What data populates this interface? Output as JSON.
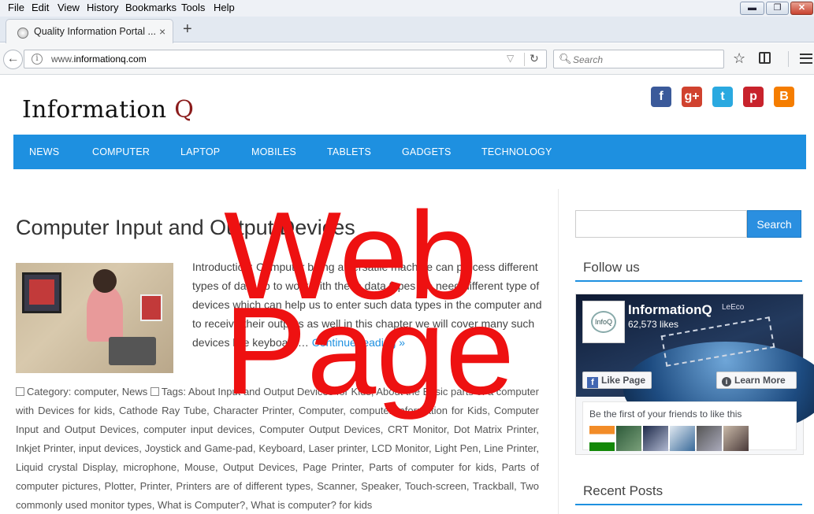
{
  "menu": {
    "items": [
      "File",
      "Edit",
      "View",
      "History",
      "Bookmarks",
      "Tools",
      "Help"
    ]
  },
  "window_controls": {
    "minimize": "▬",
    "restore": "❐",
    "close": "✕"
  },
  "tab": {
    "title": "Quality Information Portal ...",
    "close": "×",
    "new_tab": "+"
  },
  "navbar": {
    "back": "←",
    "url_prefix": "www.",
    "url_domain": "informationq.com",
    "search_placeholder": "Search",
    "info": "i"
  },
  "icons": {
    "back": "back-arrow-icon",
    "reload": "reload-icon",
    "bookmark": "star-icon",
    "reader": "reading-list-icon",
    "menu": "hamburger-icon",
    "search": "magnifier-icon"
  },
  "site": {
    "logo_main": "Information ",
    "logo_q": "Q",
    "social": [
      "f",
      "g+",
      "t",
      "p",
      "B"
    ],
    "nav": [
      "NEWS",
      "COMPUTER",
      "LAPTOP",
      "MOBILES",
      "TABLETS",
      "GADGETS",
      "TECHNOLOGY"
    ],
    "accent_color": "#1e90e0"
  },
  "post": {
    "title": "Computer Input and Output Devices",
    "excerpt": "Introduction: Computer being a versatile machine can process different types of data so to work with these data types we need different type of devices which can help us to enter such data types in the computer and to receive their outputs as well in this chapter we will cover many such devices like keyboard… ",
    "continue": "Continue reading »",
    "category_label": "Category:",
    "categories": [
      "computer",
      "News"
    ],
    "tags_label": "Tags:",
    "tags": [
      "About Input and Output Devices for Kids",
      "About the Basic parts of a computer with Devices for kids",
      "Cathode Ray Tube",
      "Character Printer",
      "Computer",
      "computer Information for Kids",
      "Computer Input and Output Devices",
      "computer input devices",
      "Computer Output Devices",
      "CRT Monitor",
      "Dot Matrix Printer",
      "Inkjet Printer",
      "input devices",
      "Joystick and Game-pad",
      "Keyboard",
      "Laser printer",
      "LCD Monitor",
      "Light Pen",
      "Line Printer",
      "Liquid crystal Display",
      "microphone",
      "Mouse",
      "Output Devices",
      "Page Printer",
      "Parts of computer for kids",
      "Parts of computer pictures",
      "Plotter",
      "Printer",
      "Printers are of different types",
      "Scanner",
      "Speaker",
      "Touch-screen",
      "Trackball",
      "Two commonly used monitor types",
      "What is Computer?",
      "What is computer? for kids"
    ]
  },
  "sidebar": {
    "search_button": "Search",
    "follow_title": "Follow us",
    "fb_name": "InformationQ",
    "fb_likes": "62,573 likes",
    "fb_brand": "LeEco",
    "fb_like_button": "Like Page",
    "fb_learn_button": "Learn More",
    "fb_friends_text": "Be the first of your friends to like this",
    "recent_title": "Recent Posts"
  },
  "overlay": {
    "line1": "Web",
    "line2": "Page",
    "color": "#ee1111"
  }
}
